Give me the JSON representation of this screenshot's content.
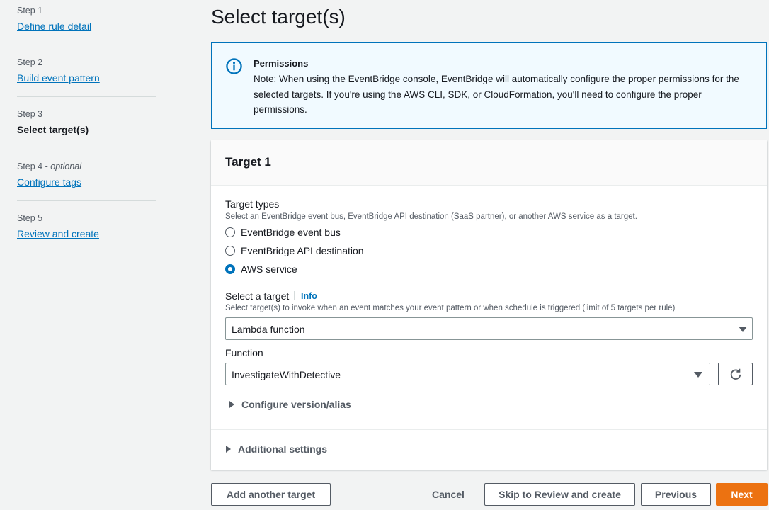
{
  "sidebar": {
    "steps": [
      {
        "num": "Step 1",
        "label": "Define rule detail"
      },
      {
        "num": "Step 2",
        "label": "Build event pattern"
      },
      {
        "num": "Step 3",
        "label": "Select target(s)"
      },
      {
        "num": "Step 4",
        "num_suffix": "optional",
        "label": "Configure tags"
      },
      {
        "num": "Step 5",
        "label": "Review and create"
      }
    ]
  },
  "page": {
    "title": "Select target(s)"
  },
  "alert": {
    "title": "Permissions",
    "body": "Note: When using the EventBridge console, EventBridge will automatically configure the proper permissions for the selected targets. If you're using the AWS CLI, SDK, or CloudFormation, you'll need to configure the proper permissions."
  },
  "target": {
    "title": "Target 1",
    "types_label": "Target types",
    "types_desc": "Select an EventBridge event bus, EventBridge API destination (SaaS partner), or another AWS service as a target.",
    "types": [
      {
        "label": "EventBridge event bus",
        "selected": false
      },
      {
        "label": "EventBridge API destination",
        "selected": false
      },
      {
        "label": "AWS service",
        "selected": true
      }
    ],
    "select_label": "Select a target",
    "info": "Info",
    "select_desc": "Select target(s) to invoke when an event matches your event pattern or when schedule is triggered (limit of 5 targets per rule)",
    "select_value": "Lambda function",
    "function_label": "Function",
    "function_value": "InvestigateWithDetective",
    "configure_version": "Configure version/alias",
    "additional_settings": "Additional settings"
  },
  "footer": {
    "add_target": "Add another target",
    "cancel": "Cancel",
    "skip": "Skip to Review and create",
    "previous": "Previous",
    "next": "Next"
  },
  "colors": {
    "link": "#0073bb",
    "primary": "#ec7211",
    "info_bg": "#f1faff"
  }
}
